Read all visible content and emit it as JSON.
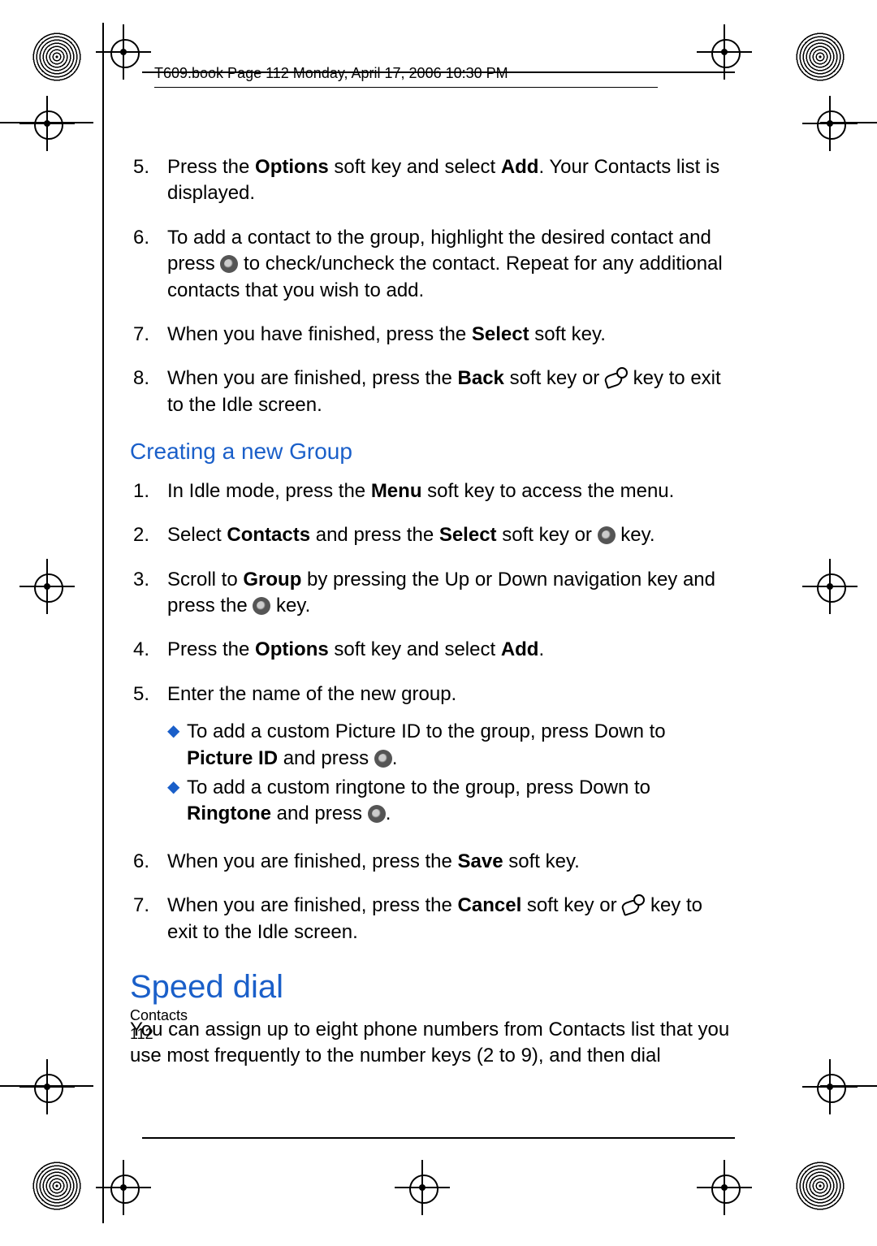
{
  "header": {
    "text": "T609.book  Page 112  Monday, April 17, 2006  10:30 PM"
  },
  "footer": {
    "section": "Contacts",
    "page": "112"
  },
  "steps_top": [
    {
      "n": "5.",
      "parts": [
        "Press the ",
        "Options",
        " soft key and select ",
        "Add",
        ". Your Contacts list is displayed."
      ]
    },
    {
      "n": "6.",
      "parts": [
        "To add a contact to the group, highlight the desired contact and press ",
        "@OK",
        " to check/uncheck the contact. Repeat for any additional contacts that you wish to add."
      ]
    },
    {
      "n": "7.",
      "parts": [
        "When you have finished, press the ",
        "Select",
        " soft key."
      ]
    },
    {
      "n": "8.",
      "parts": [
        "When you are finished, press the ",
        "Back",
        " soft key or  ",
        "@END",
        "  key to exit to the Idle screen."
      ]
    }
  ],
  "heading2": "Creating a new Group",
  "steps_group": [
    {
      "n": "1.",
      "parts": [
        "In Idle mode, press the ",
        "Menu",
        " soft key to access the menu."
      ]
    },
    {
      "n": "2.",
      "parts": [
        "Select ",
        "Contacts",
        " and press the ",
        "Select",
        " soft key or ",
        "@OK",
        " key."
      ]
    },
    {
      "n": "3.",
      "parts": [
        "Scroll to ",
        "Group",
        " by pressing the Up or Down navigation key and press the ",
        "@OK",
        " key."
      ]
    },
    {
      "n": "4.",
      "parts": [
        "Press the ",
        "Options",
        " soft key and select ",
        "Add",
        "."
      ]
    },
    {
      "n": "5.",
      "parts": [
        "Enter the name of the new group."
      ],
      "bullets": [
        {
          "parts": [
            "To add a custom Picture ID to the group, press Down to ",
            "Picture ID",
            " and press ",
            "@OK",
            "."
          ]
        },
        {
          "parts": [
            "To add a custom ringtone to the group, press Down to ",
            "Ringtone",
            " and press ",
            "@OK",
            "."
          ]
        }
      ]
    },
    {
      "n": "6.",
      "parts": [
        "When you are finished, press the ",
        "Save",
        " soft key."
      ]
    },
    {
      "n": "7.",
      "parts": [
        "When you are finished, press the ",
        "Cancel",
        " soft key or  ",
        "@END",
        "  key to exit to the Idle screen."
      ]
    }
  ],
  "heading1": "Speed dial",
  "speed_dial_para": "You can assign up to eight phone numbers from Contacts list that you use most frequently to the number keys (2 to 9), and then dial"
}
